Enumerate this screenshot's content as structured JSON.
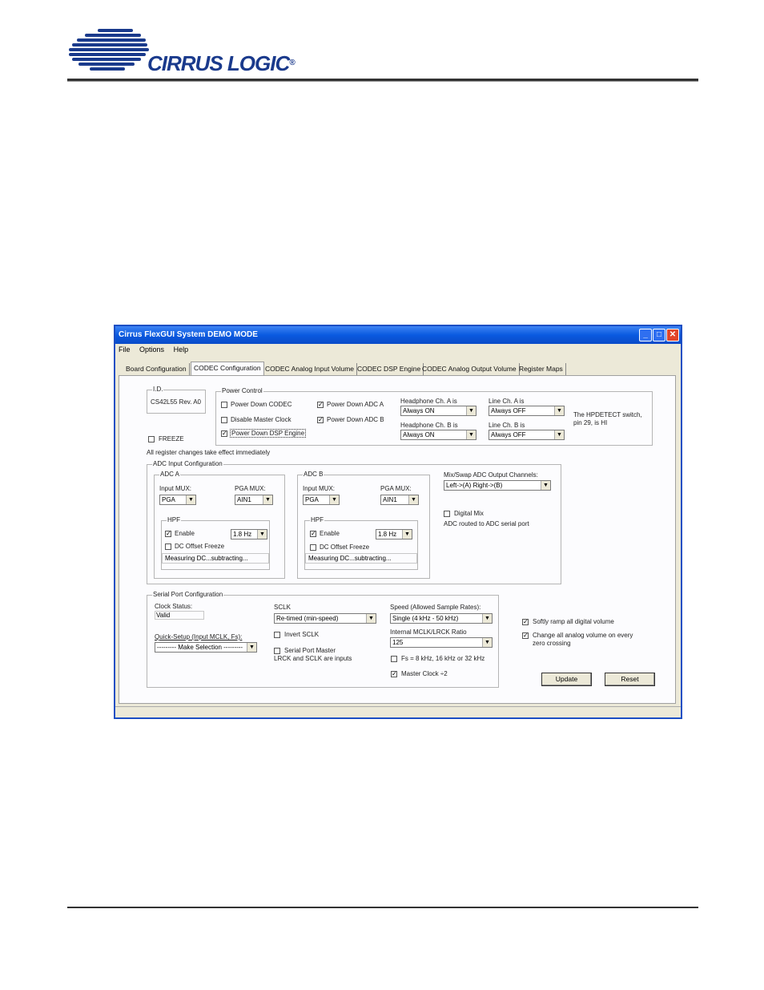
{
  "brand": {
    "name": "CIRRUS LOGIC",
    "registered": "®"
  },
  "window": {
    "title": "Cirrus FlexGUI System DEMO MODE",
    "controls": {
      "minimize": "_",
      "maximize": "□",
      "close": "✕"
    }
  },
  "menu": [
    "File",
    "Options",
    "Help"
  ],
  "tabs": [
    "Board Configuration",
    "CODEC Configuration",
    "CODEC Analog Input Volume",
    "CODEC DSP Engine",
    "CODEC Analog Output Volume",
    "Register Maps"
  ],
  "active_tab": "CODEC Configuration",
  "id_group": {
    "title": "I.D.",
    "value": "CS42L55 Rev. A0"
  },
  "freeze": {
    "label": "FREEZE",
    "checked": false
  },
  "note": "All register changes take effect immediately",
  "power_control": {
    "title": "Power Control",
    "items": [
      {
        "label": "Power Down CODEC",
        "checked": false
      },
      {
        "label": "Disable Master Clock",
        "checked": false
      },
      {
        "label": "Power Down DSP Engine",
        "checked": true
      },
      {
        "label": "Power Down ADC A",
        "checked": true
      },
      {
        "label": "Power Down ADC B",
        "checked": true
      }
    ],
    "hp_a_label": "Headphone Ch. A is",
    "hp_a_value": "Always ON",
    "hp_b_label": "Headphone Ch. B is",
    "hp_b_value": "Always ON",
    "line_a_label": "Line Ch. A is",
    "line_a_value": "Always OFF",
    "line_b_label": "Line Ch. B is",
    "line_b_value": "Always OFF",
    "hpdetect_note": "The HPDETECT switch, pin 29, is HI"
  },
  "adc_input": {
    "title": "ADC Input Configuration",
    "adc_a": {
      "title": "ADC A",
      "input_mux_label": "Input MUX:",
      "input_mux": "PGA",
      "pga_mux_label": "PGA MUX:",
      "pga_mux": "AIN1",
      "hpf_title": "HPF",
      "enable_label": "Enable",
      "enable_checked": true,
      "hpf_freq": "1.8 Hz",
      "dc_freeze_label": "DC Offset Freeze",
      "status": "Measuring DC...subtracting..."
    },
    "adc_b": {
      "title": "ADC B",
      "input_mux_label": "Input MUX:",
      "input_mux": "PGA",
      "pga_mux_label": "PGA MUX:",
      "pga_mux": "AIN1",
      "hpf_title": "HPF",
      "enable_label": "Enable",
      "enable_checked": true,
      "hpf_freq": "1.8 Hz",
      "dc_freeze_label": "DC Offset Freeze",
      "status": "Measuring DC...subtracting..."
    },
    "mix_swap_label": "Mix/Swap ADC Output Channels:",
    "mix_swap_value": "Left->(A) Right->(B)",
    "digital_mix_label": "Digital Mix",
    "adc_route_note": "ADC routed to ADC serial port"
  },
  "serial_port": {
    "title": "Serial Port Configuration",
    "clock_status_label": "Clock Status:",
    "clock_status": "Valid",
    "quick_setup_label": "Quick-Setup (Input MCLK, Fs):",
    "quick_setup_value": "--------- Make Selection ---------",
    "sclk_label": "SCLK",
    "sclk_value": "Re-timed (min-speed)",
    "invert_sclk": "Invert SCLK",
    "serial_master_1": "Serial Port Master",
    "serial_master_2": "LRCK and SCLK are inputs",
    "speed_label": "Speed (Allowed Sample Rates):",
    "speed_value": "Single (4 kHz - 50 kHz)",
    "ratio_label": "Internal MCLK/LRCK Ratio",
    "ratio_value": "125",
    "fs_label": "Fs = 8 kHz, 16 kHz or 32 kHz",
    "master_clock_label": "Master Clock ÷2"
  },
  "options": {
    "soft_ramp": "Softly ramp all digital volume",
    "zero_cross": "Change all analog volume on every zero crossing"
  },
  "buttons": {
    "update": "Update",
    "reset": "Reset"
  },
  "colors": {
    "brand_blue": "#1a3a8c",
    "title_bar": "#0a5ae0",
    "window_bg": "#ece9d8"
  }
}
